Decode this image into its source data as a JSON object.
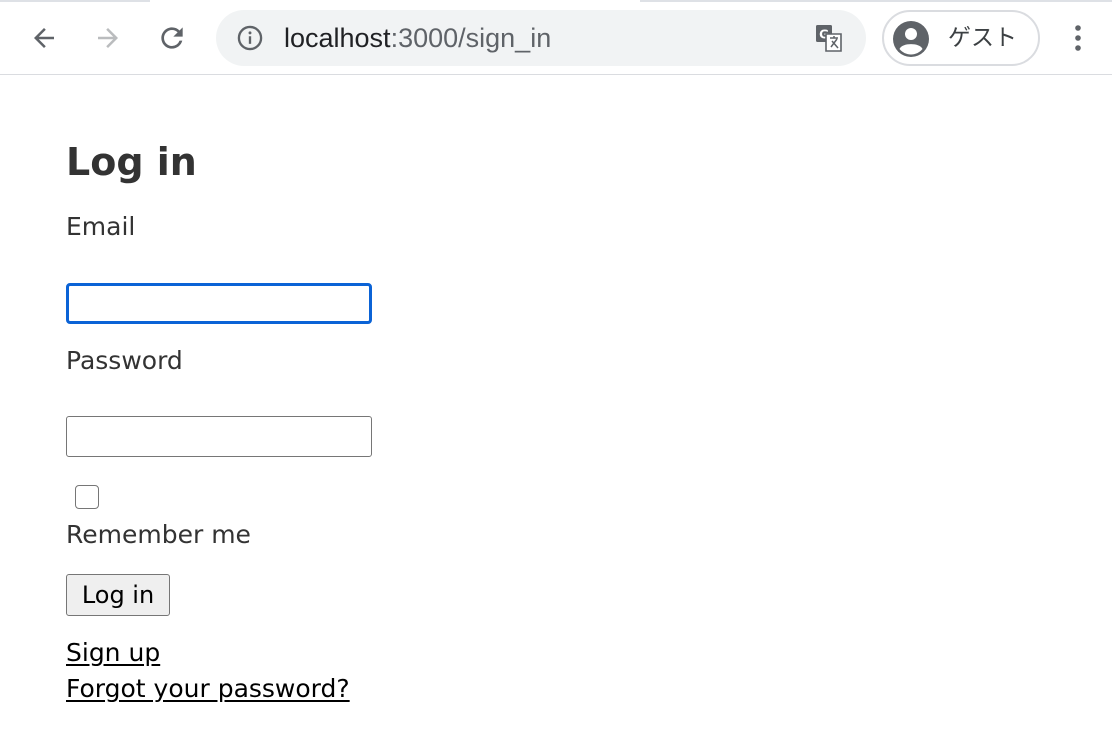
{
  "browser": {
    "url_host": "localhost",
    "url_path": ":3000/sign_in",
    "profile_label": "ゲスト",
    "icons": {
      "back": "back-arrow-icon",
      "forward": "forward-arrow-icon",
      "reload": "reload-icon",
      "site_info": "info-icon",
      "translate": "translate-icon",
      "profile": "profile-avatar-icon",
      "menu": "kebab-menu-icon"
    },
    "forward_disabled": true
  },
  "form": {
    "title": "Log in",
    "email_label": "Email",
    "email_value": "",
    "password_label": "Password",
    "password_value": "",
    "remember_label": "Remember me",
    "remember_checked": false,
    "submit_label": "Log in"
  },
  "links": {
    "sign_up": "Sign up",
    "forgot_password": "Forgot your password?"
  },
  "colors": {
    "focus_ring": "#0b63d6",
    "text": "#333333",
    "toolbar_bg": "#ffffff",
    "omnibox_bg": "#f1f3f4"
  }
}
